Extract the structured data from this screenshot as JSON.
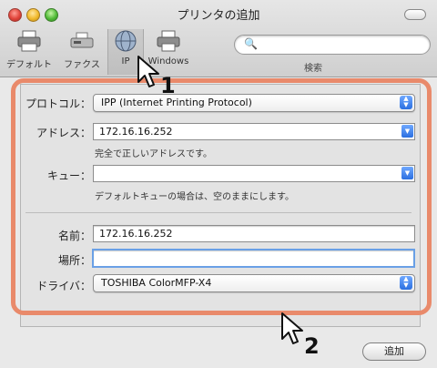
{
  "window": {
    "title": "プリンタの追加"
  },
  "toolbar": {
    "items": [
      {
        "label": "デフォルト",
        "icon": "printer-default-icon"
      },
      {
        "label": "ファクス",
        "icon": "fax-icon"
      },
      {
        "label": "IP",
        "icon": "ip-globe-icon",
        "selected": true
      },
      {
        "label": "Windows",
        "icon": "windows-printer-icon"
      }
    ],
    "search": {
      "label": "検索",
      "value": ""
    }
  },
  "form": {
    "protocol": {
      "label": "プロトコル：",
      "value": "IPP (Internet Printing Protocol)"
    },
    "address": {
      "label": "アドレス：",
      "value": "172.16.16.252",
      "hint": "完全で正しいアドレスです。"
    },
    "queue": {
      "label": "キュー：",
      "value": "",
      "hint": "デフォルトキューの場合は、空のままにします。"
    },
    "name": {
      "label": "名前：",
      "value": "172.16.16.252"
    },
    "location": {
      "label": "場所：",
      "value": ""
    },
    "driver": {
      "label": "ドライバ：",
      "value": "TOSHIBA ColorMFP-X4"
    }
  },
  "buttons": {
    "add": "追加"
  },
  "callouts": {
    "step1": "1",
    "step2": "2"
  },
  "colors": {
    "highlight": "#e98a6b",
    "accent": "#2b6fe0"
  }
}
